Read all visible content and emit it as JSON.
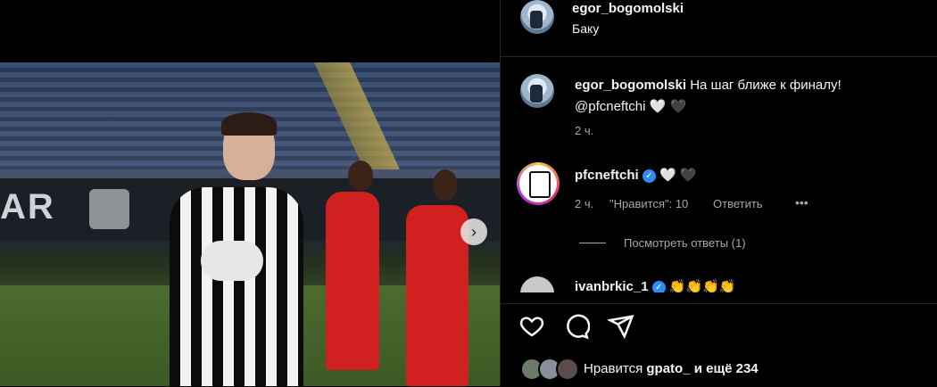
{
  "header": {
    "username": "egor_bogomolski",
    "location": "Баку"
  },
  "caption": {
    "username": "egor_bogomolski",
    "text_line1": "На шаг ближе к финалу!",
    "mention": "@pfcneftchi",
    "emoji": [
      "🤍",
      "🖤"
    ],
    "time": "2 ч."
  },
  "comment": {
    "username": "pfcneftchi",
    "emoji": [
      "🤍",
      "🖤"
    ],
    "time": "2 ч.",
    "likes": "\"Нравится\": 10",
    "reply_label": "Ответить",
    "more": "•••",
    "view_replies": "Посмотреть ответы (1)"
  },
  "comment2": {
    "username": "ivanbrkic_1",
    "emoji": "👏👏👏👏"
  },
  "likes": {
    "prefix": "Нравится",
    "user": "gpato_",
    "suffix": "и ещё 234"
  },
  "colors": {
    "background": "#000000",
    "text": "#f5f5f5",
    "secondary": "#a8a8a8",
    "verified": "#2f8cf5",
    "divider": "#262626"
  },
  "icons": [
    "heart-icon",
    "comment-icon",
    "share-icon",
    "next-arrow-icon",
    "verified-icon"
  ],
  "photo": {
    "board_text": "AR",
    "next_arrow": "›"
  }
}
